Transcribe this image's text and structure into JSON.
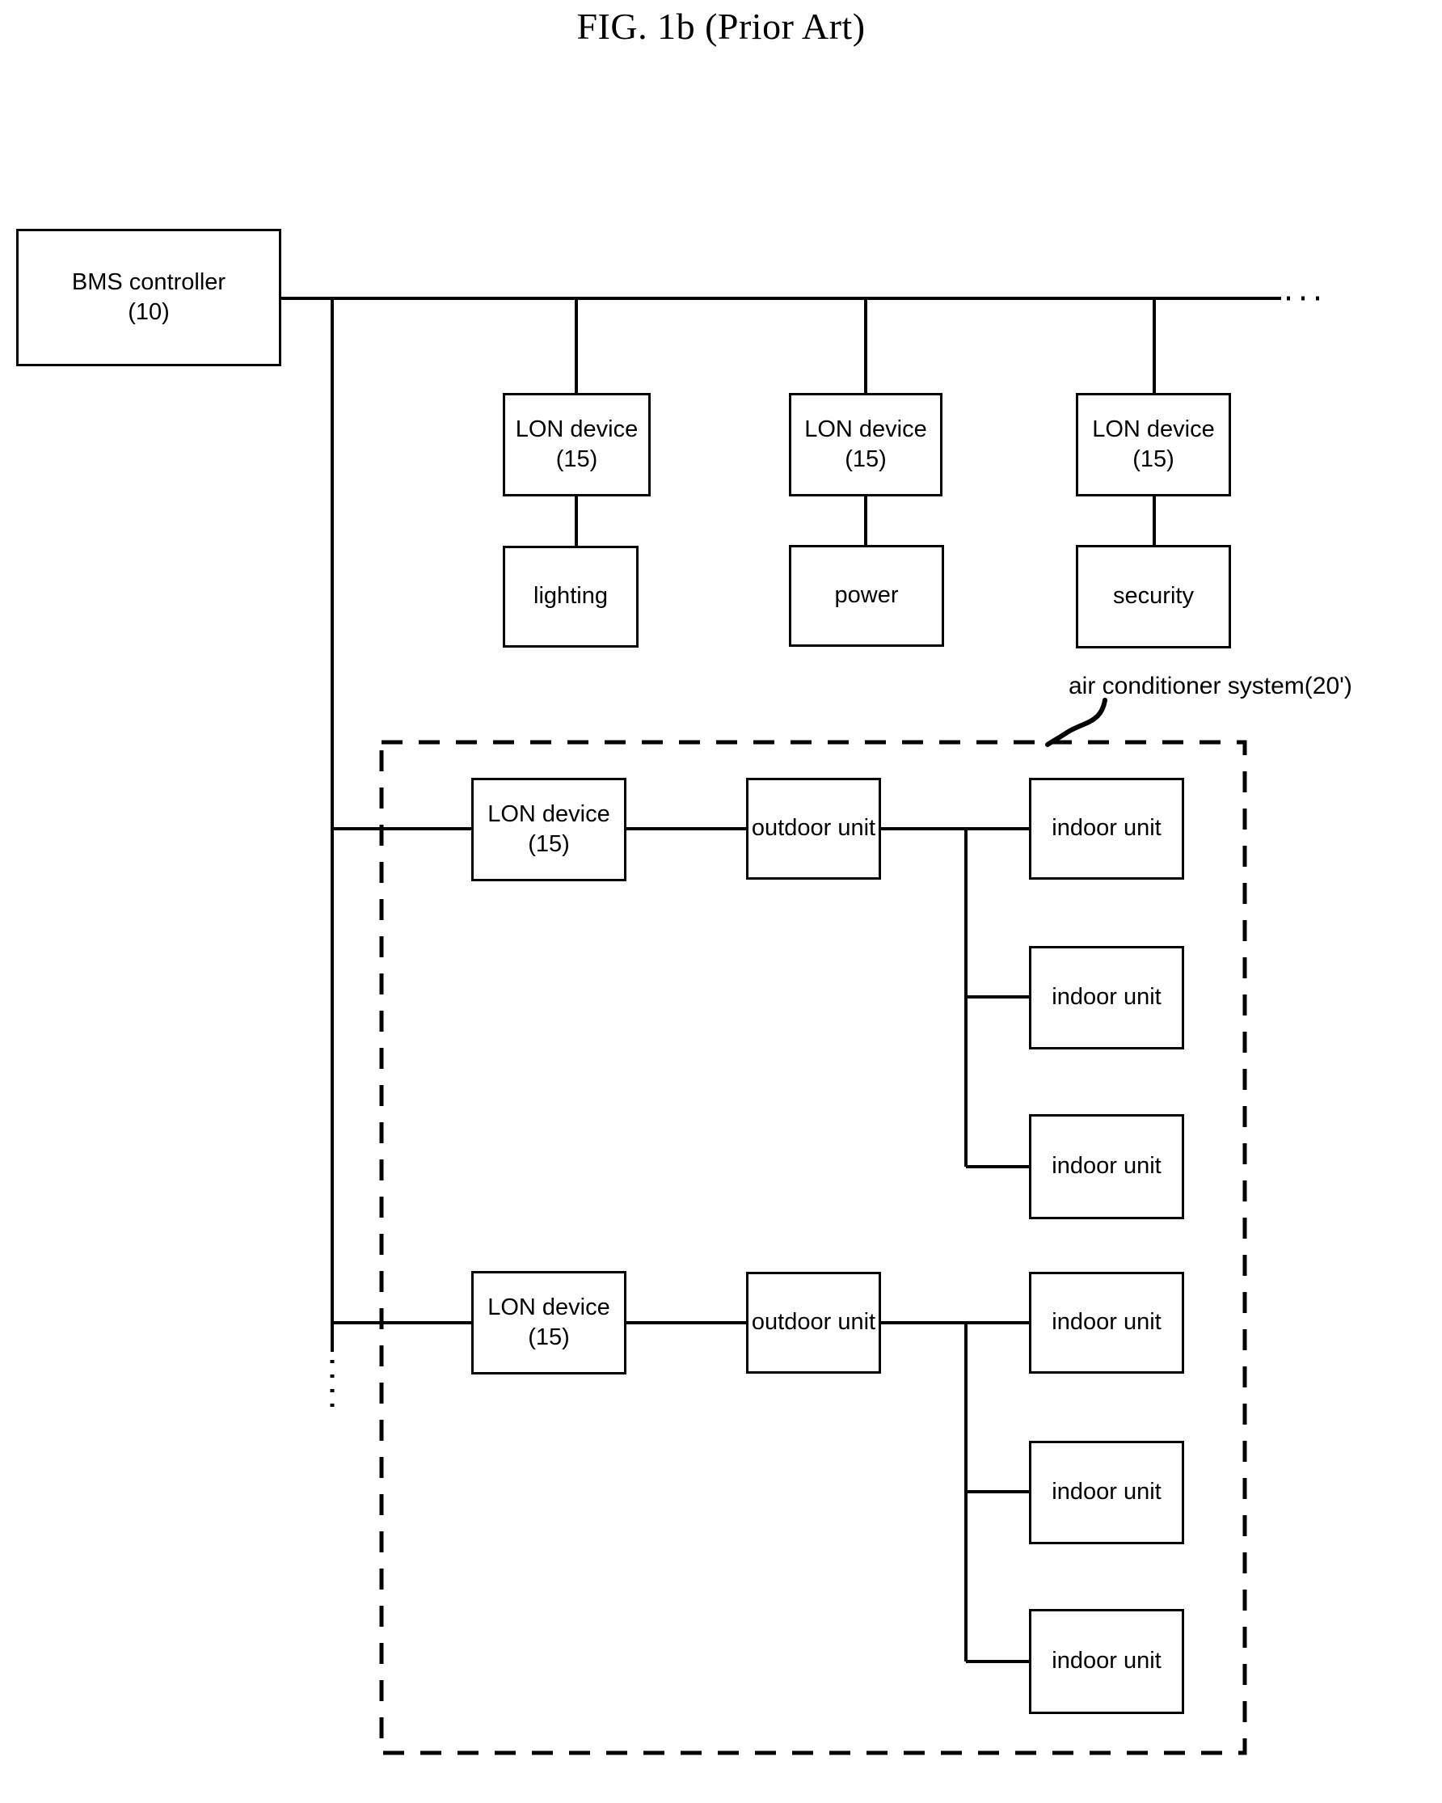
{
  "figure": {
    "title": "FIG. 1b (Prior Art)"
  },
  "nodes": {
    "bms_controller": {
      "line1": "BMS controller",
      "line2": "(10)"
    },
    "lon_device_lighting": {
      "line1": "LON device",
      "line2": "(15)"
    },
    "lon_device_power": {
      "line1": "LON device",
      "line2": "(15)"
    },
    "lon_device_security": {
      "line1": "LON device",
      "line2": "(15)"
    },
    "lighting": {
      "line1": "lighting",
      "line2": ""
    },
    "power": {
      "line1": "power",
      "line2": ""
    },
    "security": {
      "line1": "security",
      "line2": ""
    },
    "lon_device_ac1": {
      "line1": "LON device",
      "line2": "(15)"
    },
    "lon_device_ac2": {
      "line1": "LON device",
      "line2": "(15)"
    },
    "outdoor_unit_1": {
      "line1": "outdoor unit",
      "line2": ""
    },
    "outdoor_unit_2": {
      "line1": "outdoor unit",
      "line2": ""
    },
    "indoor_unit_1_1": {
      "line1": "indoor unit",
      "line2": ""
    },
    "indoor_unit_1_2": {
      "line1": "indoor unit",
      "line2": ""
    },
    "indoor_unit_1_3": {
      "line1": "indoor unit",
      "line2": ""
    },
    "indoor_unit_2_1": {
      "line1": "indoor unit",
      "line2": ""
    },
    "indoor_unit_2_2": {
      "line1": "indoor unit",
      "line2": ""
    },
    "indoor_unit_2_3": {
      "line1": "indoor unit",
      "line2": ""
    }
  },
  "annotations": {
    "air_conditioner_system": "air conditioner system(20')"
  },
  "colors": {
    "stroke": "#000000",
    "background": "#ffffff"
  },
  "diagram_data": {
    "type": "block-diagram",
    "description": "Prior-art building management system: a BMS controller connected over a LON bus to several LON devices, each controlling lighting, power, security, or an air conditioner system comprising outdoor units with multiple indoor units.",
    "bus": {
      "name": "LON bus",
      "continuation_markers": [
        "horizontal-right-dots",
        "vertical-bottom-dots"
      ]
    },
    "groups": [
      {
        "label": "air conditioner system(20')",
        "border": "dashed",
        "members": [
          "lon_device_ac1",
          "outdoor_unit_1",
          "indoor_unit_1_1",
          "indoor_unit_1_2",
          "indoor_unit_1_3",
          "lon_device_ac2",
          "outdoor_unit_2",
          "indoor_unit_2_1",
          "indoor_unit_2_2",
          "indoor_unit_2_3"
        ]
      }
    ],
    "edges": [
      [
        "bms_controller",
        "bus"
      ],
      [
        "bus",
        "lon_device_lighting"
      ],
      [
        "bus",
        "lon_device_power"
      ],
      [
        "bus",
        "lon_device_security"
      ],
      [
        "lon_device_lighting",
        "lighting"
      ],
      [
        "lon_device_power",
        "power"
      ],
      [
        "lon_device_security",
        "security"
      ],
      [
        "bus",
        "lon_device_ac1"
      ],
      [
        "lon_device_ac1",
        "outdoor_unit_1"
      ],
      [
        "outdoor_unit_1",
        "indoor_unit_1_1"
      ],
      [
        "outdoor_unit_1",
        "indoor_unit_1_2"
      ],
      [
        "outdoor_unit_1",
        "indoor_unit_1_3"
      ],
      [
        "bus",
        "lon_device_ac2"
      ],
      [
        "lon_device_ac2",
        "outdoor_unit_2"
      ],
      [
        "outdoor_unit_2",
        "indoor_unit_2_1"
      ],
      [
        "outdoor_unit_2",
        "indoor_unit_2_2"
      ],
      [
        "outdoor_unit_2",
        "indoor_unit_2_3"
      ]
    ]
  }
}
